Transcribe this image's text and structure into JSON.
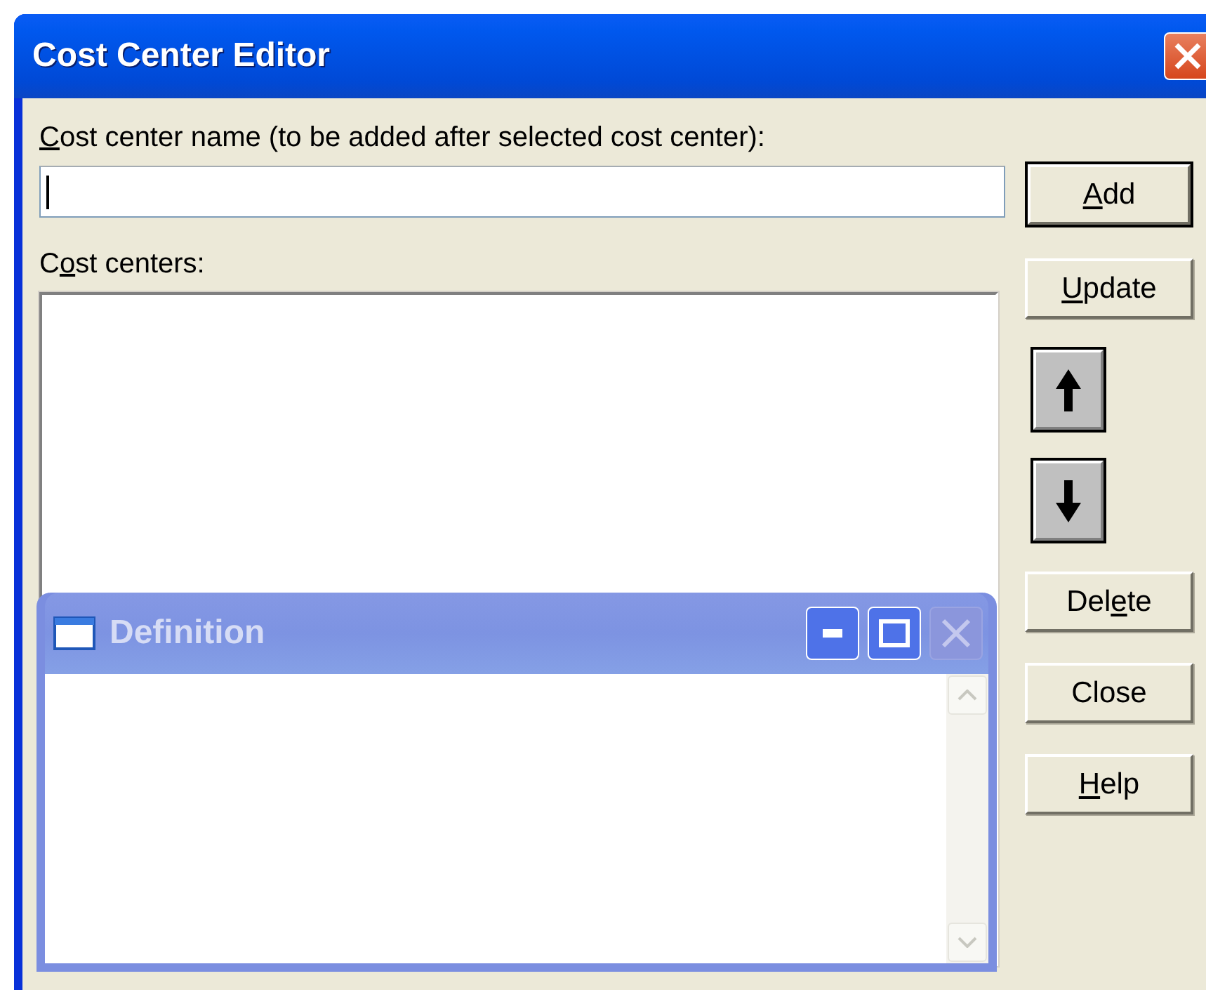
{
  "window": {
    "title": "Cost Center Editor"
  },
  "name_field": {
    "label": {
      "key": "C",
      "post": "ost center name (to be added after selected cost center):"
    },
    "focused": true
  },
  "list": {
    "label": {
      "pre": "C",
      "key": "o",
      "post": "st centers:"
    }
  },
  "buttons": [
    {
      "kind": "text",
      "label": {
        "key": "A",
        "post": "dd"
      },
      "default": true
    },
    {
      "kind": "text",
      "label": {
        "key": "U",
        "post": "pdate"
      },
      "default": false
    },
    {
      "kind": "up"
    },
    {
      "kind": "down"
    },
    {
      "kind": "text",
      "label": {
        "pre": "Del",
        "key": "e",
        "post": "te"
      },
      "default": false
    },
    {
      "kind": "text",
      "label": {
        "pre": "Close"
      },
      "default": false
    },
    {
      "kind": "text",
      "label": {
        "key": "H",
        "post": "elp"
      },
      "default": false
    }
  ],
  "definition": {
    "title": "Definition",
    "active": false
  }
}
